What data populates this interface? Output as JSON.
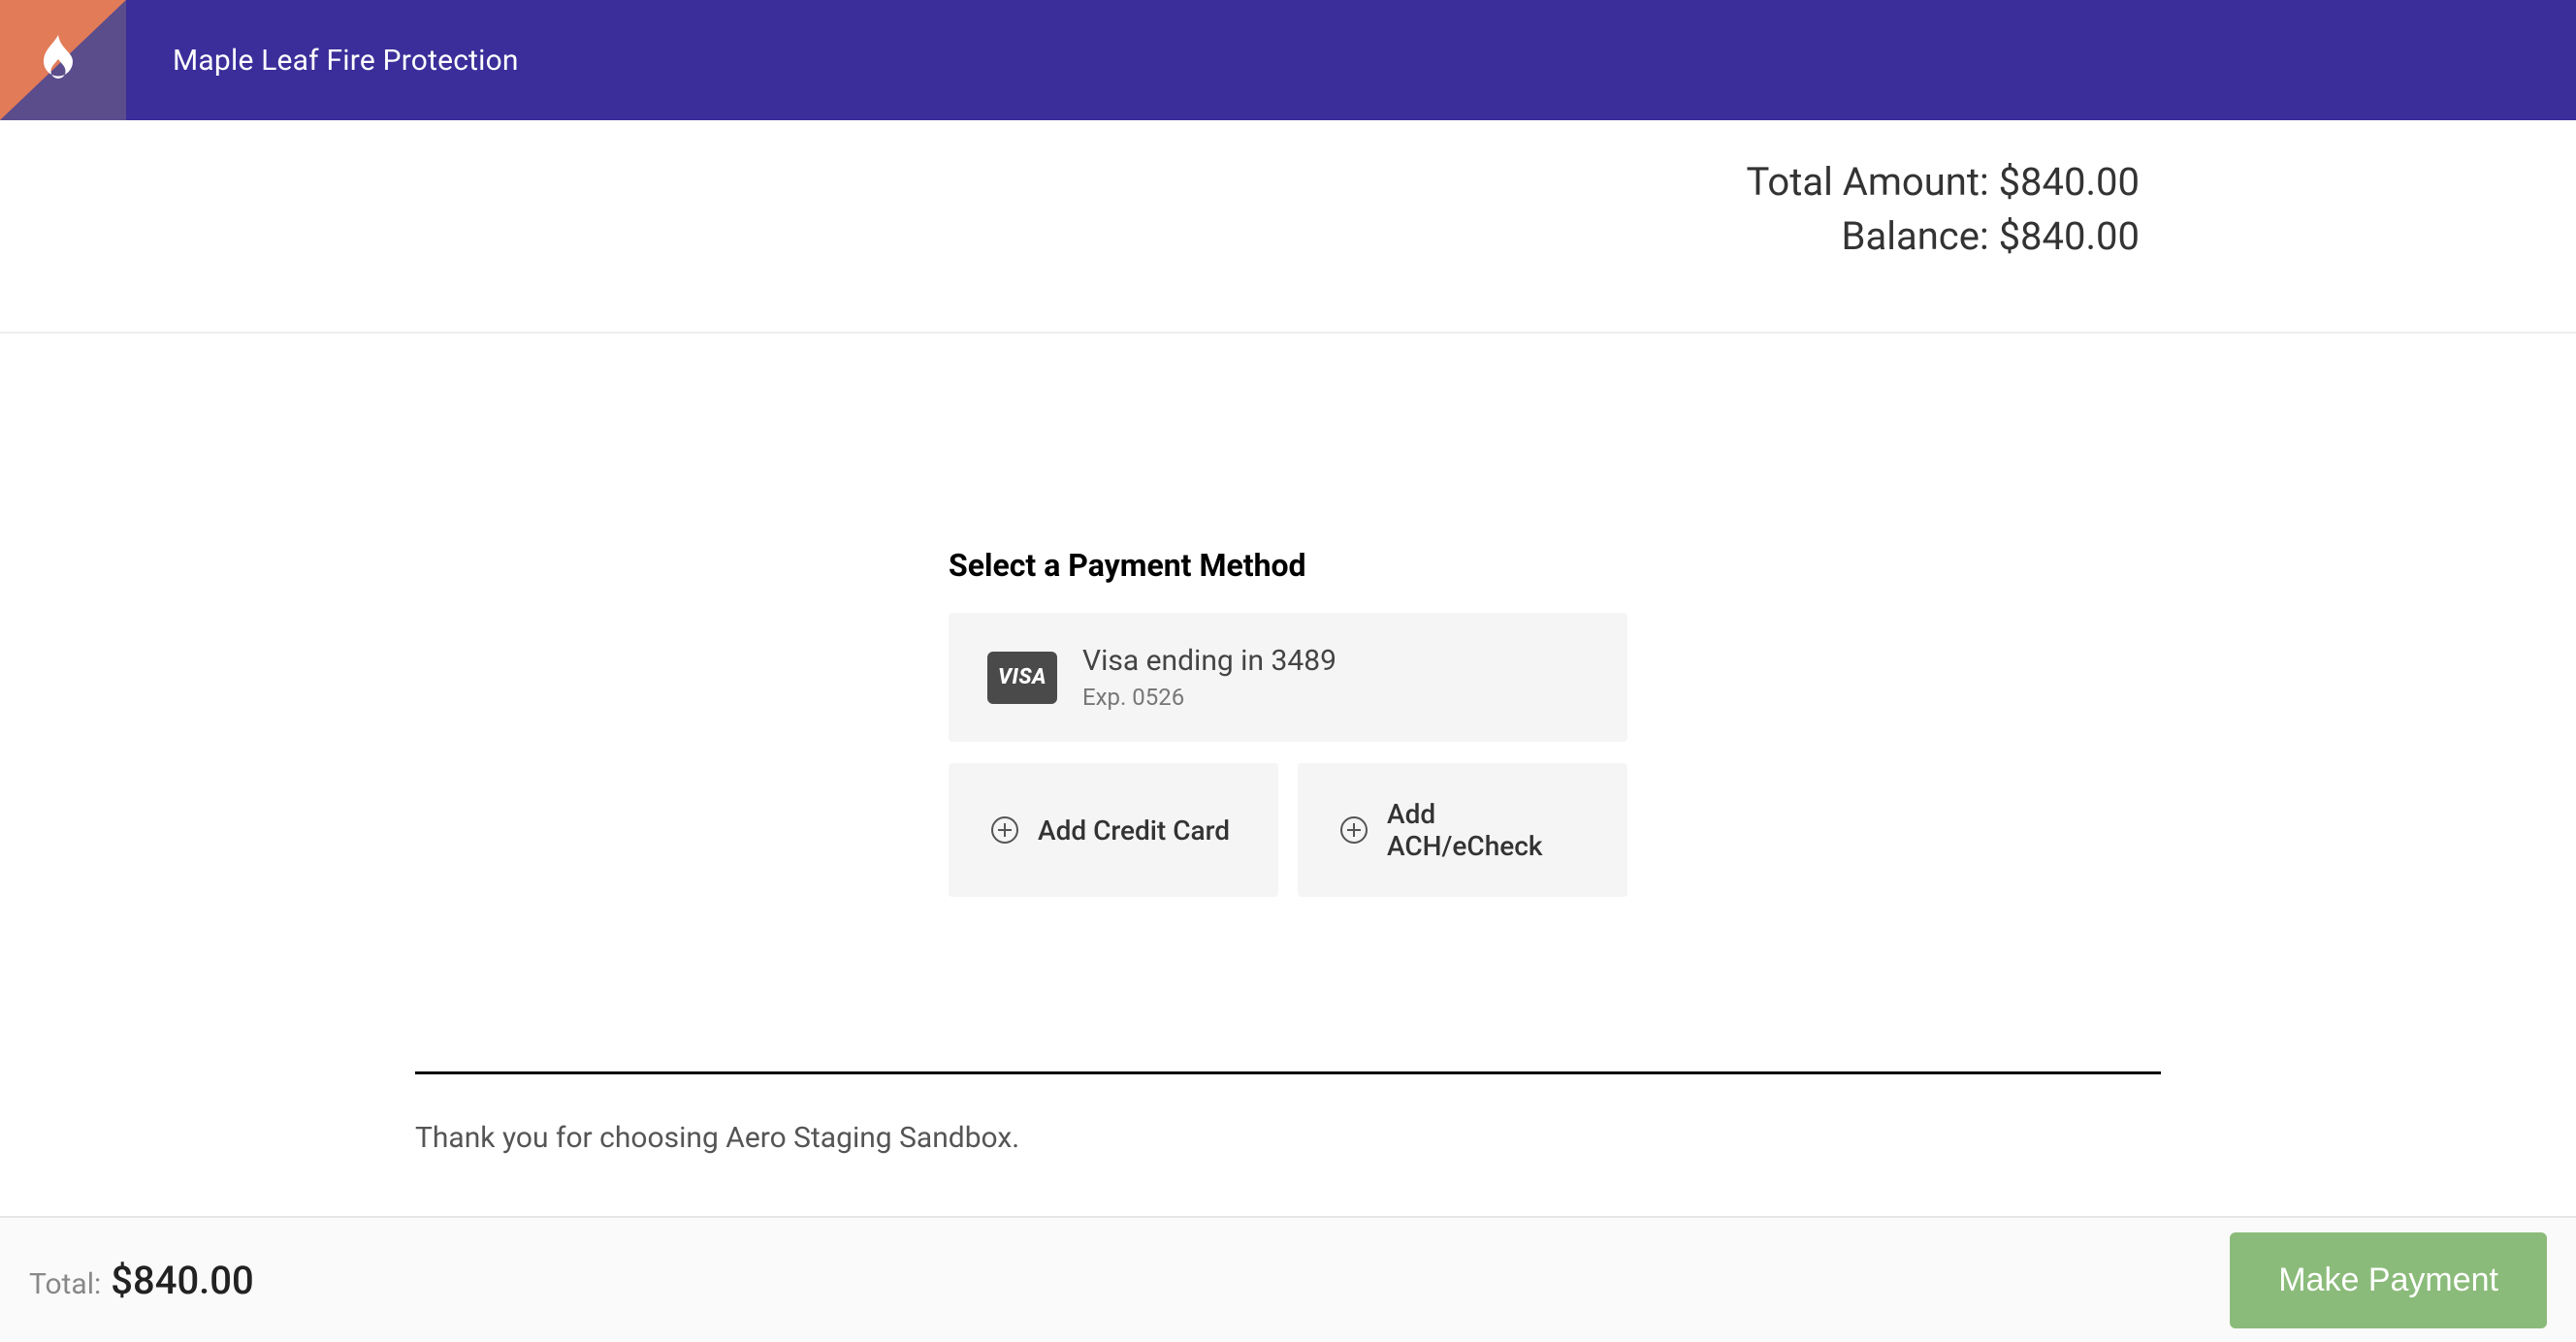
{
  "header": {
    "company_name": "Maple Leaf Fire Protection"
  },
  "summary": {
    "total_label": "Total Amount:",
    "total_value": "$840.00",
    "balance_label": "Balance:",
    "balance_value": "$840.00"
  },
  "payment": {
    "section_title": "Select a Payment Method",
    "card": {
      "brand": "VISA",
      "description": "Visa ending in 3489",
      "expiry": "Exp. 0526"
    },
    "add_credit_card": "Add Credit Card",
    "add_ach": "Add ACH/eCheck"
  },
  "footer_note": "Thank you for choosing Aero Staging Sandbox.",
  "bottom_bar": {
    "total_label": "Total:",
    "total_value": "$840.00",
    "make_payment": "Make Payment"
  }
}
